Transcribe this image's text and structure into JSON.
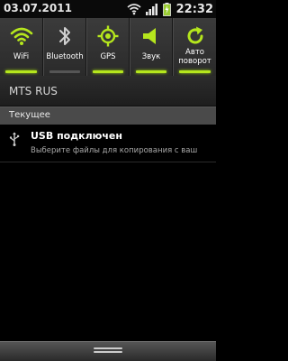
{
  "status_bar": {
    "date": "03.07.2011",
    "time": "22:32",
    "icons": [
      "wifi-icon",
      "signal-icon",
      "battery-charging-icon"
    ]
  },
  "toggles": [
    {
      "label": "WiFi",
      "icon": "wifi-icon",
      "active": true
    },
    {
      "label": "Bluetooth",
      "icon": "bluetooth-icon",
      "active": false
    },
    {
      "label": "GPS",
      "icon": "gps-icon",
      "active": true
    },
    {
      "label": "Звук",
      "icon": "sound-icon",
      "active": true
    },
    {
      "label": "Авто поворот",
      "icon": "auto-rotate-icon",
      "active": true
    }
  ],
  "carrier": {
    "name": "MTS RUS"
  },
  "section": {
    "title": "Текущее"
  },
  "notification": {
    "title": "USB подключен",
    "text": "Выберите файлы для копирования с ваш",
    "icon": "usb-icon"
  },
  "colors": {
    "accent": "#b5e61d",
    "background": "#000000"
  }
}
